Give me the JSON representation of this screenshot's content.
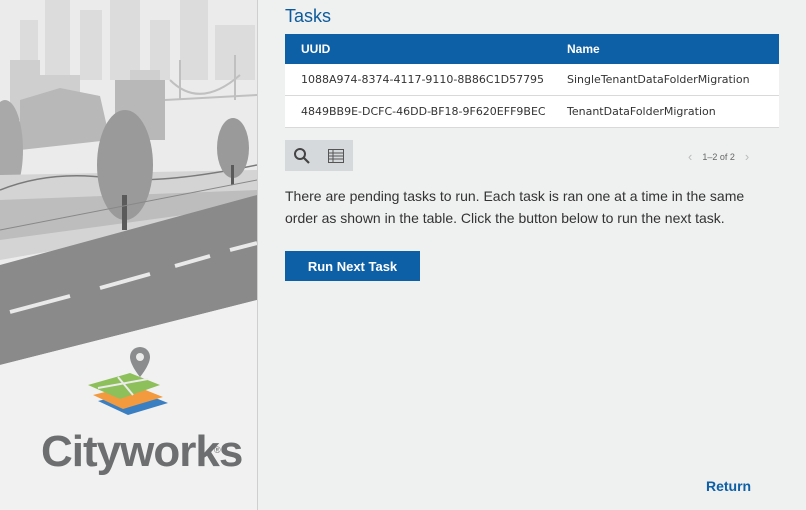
{
  "brand": {
    "name": "Cityworks",
    "reg_mark": "®"
  },
  "tasks": {
    "title": "Tasks",
    "columns": [
      "UUID",
      "Name"
    ],
    "rows": [
      {
        "uuid": "1088A974-8374-4117-9110-8B86C1D57795",
        "name": "SingleTenantDataFolderMigration"
      },
      {
        "uuid": "4849BB9E-DCFC-46DD-BF18-9F620EFF9BEC",
        "name": "TenantDataFolderMigration"
      }
    ],
    "pager": {
      "text": "1–2 of 2"
    }
  },
  "icons": {
    "search": "search-icon",
    "columns": "table-columns-icon",
    "prev": "chevron-left-icon",
    "next": "chevron-right-icon"
  },
  "message": "There are pending tasks to run. Each task is ran one at a time in the same order as shown in the table. Click the button below to run the next task.",
  "actions": {
    "run_next": "Run Next Task",
    "return": "Return"
  },
  "colors": {
    "accent": "#0d5fa6",
    "title": "#0d5b9c",
    "background": "#eff0f0"
  }
}
